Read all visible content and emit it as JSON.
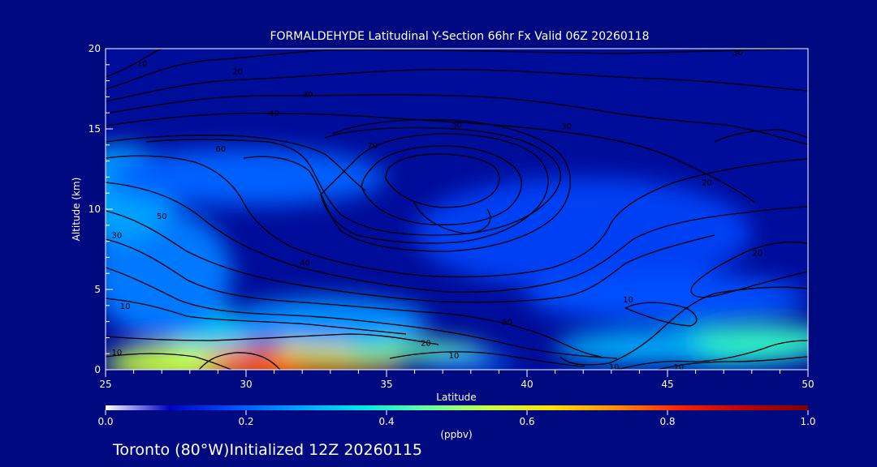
{
  "chart_data": {
    "type": "heatmap",
    "title": "FORMALDEHYDE Latitudinal Y-Section 66hr  Fx Valid 06Z 20260118",
    "xlabel": "Latitude",
    "ylabel": "Altitude (km)",
    "xlim": [
      25,
      50
    ],
    "ylim": [
      0,
      20
    ],
    "x_ticks": [
      "25",
      "30",
      "35",
      "40",
      "45",
      "50"
    ],
    "y_ticks": [
      "0",
      "5",
      "10",
      "15",
      "20"
    ],
    "colorbar": {
      "unit": "(ppbv)",
      "range": [
        0.0,
        1.0
      ],
      "ticks": [
        "0.0",
        "0.2",
        "0.4",
        "0.6",
        "0.8",
        "1.0"
      ],
      "colors": [
        "#ffffff",
        "#0000c8",
        "#0050ff",
        "#00a0ff",
        "#00e6e6",
        "#60ffa0",
        "#c8ff40",
        "#ffe000",
        "#ff8c00",
        "#ff2000",
        "#c00000",
        "#800000"
      ]
    },
    "contour_labels": [
      {
        "text": "10",
        "lat": 26.3,
        "alt": 19.1
      },
      {
        "text": "20",
        "lat": 29.7,
        "alt": 18.6
      },
      {
        "text": "30",
        "lat": 32.2,
        "alt": 17.2
      },
      {
        "text": "40",
        "lat": 31.0,
        "alt": 16.0
      },
      {
        "text": "50",
        "lat": 37.5,
        "alt": 15.3
      },
      {
        "text": "30",
        "lat": 47.5,
        "alt": 19.8
      },
      {
        "text": "30",
        "lat": 41.4,
        "alt": 15.2
      },
      {
        "text": "20",
        "lat": 46.4,
        "alt": 11.7
      },
      {
        "text": "60",
        "lat": 29.1,
        "alt": 13.8
      },
      {
        "text": "70",
        "lat": 34.5,
        "alt": 14.0
      },
      {
        "text": "50",
        "lat": 27.0,
        "alt": 9.6
      },
      {
        "text": "30",
        "lat": 25.4,
        "alt": 8.4
      },
      {
        "text": "40",
        "lat": 32.1,
        "alt": 6.7
      },
      {
        "text": "50",
        "lat": 39.3,
        "alt": 3.0
      },
      {
        "text": "10",
        "lat": 25.7,
        "alt": 4.0
      },
      {
        "text": "10",
        "lat": 43.6,
        "alt": 4.4
      },
      {
        "text": "20",
        "lat": 48.2,
        "alt": 7.3
      },
      {
        "text": "10",
        "lat": 25.4,
        "alt": 1.1
      },
      {
        "text": "20",
        "lat": 36.4,
        "alt": 1.7
      },
      {
        "text": "10",
        "lat": 37.4,
        "alt": 0.9
      },
      {
        "text": "10",
        "lat": 43.1,
        "alt": 0.2
      },
      {
        "text": "10",
        "lat": 45.4,
        "alt": 0.2
      }
    ],
    "heat_blobs": [
      {
        "lat": 28.0,
        "alt": 0.4,
        "rx": 3.0,
        "ry": 1.2,
        "value": 0.5
      },
      {
        "lat": 32.0,
        "alt": 0.3,
        "rx": 3.5,
        "ry": 1.2,
        "value": 0.75
      },
      {
        "lat": 33.5,
        "alt": 0.5,
        "rx": 1.8,
        "ry": 1.0,
        "value": 1.0
      },
      {
        "lat": 33.5,
        "alt": 1.3,
        "rx": 2.5,
        "ry": 0.8,
        "value": 0.55
      },
      {
        "lat": 36.0,
        "alt": 1.2,
        "rx": 2.5,
        "ry": 0.6,
        "value": 0.4
      },
      {
        "lat": 38.0,
        "alt": 0.5,
        "rx": 1.5,
        "ry": 0.5,
        "value": 0.15
      },
      {
        "lat": 29.0,
        "alt": 2.5,
        "rx": 2.0,
        "ry": 1.2,
        "value": 0.25
      },
      {
        "lat": 33.0,
        "alt": 3.0,
        "rx": 3.5,
        "ry": 1.5,
        "value": 0.18
      },
      {
        "lat": 27.0,
        "alt": 6.0,
        "rx": 2.5,
        "ry": 4.0,
        "value": 0.15
      },
      {
        "lat": 25.5,
        "alt": 11.0,
        "rx": 2.0,
        "ry": 3.0,
        "value": 0.2
      },
      {
        "lat": 30.0,
        "alt": 12.0,
        "rx": 5.0,
        "ry": 1.8,
        "value": 0.12
      },
      {
        "lat": 42.0,
        "alt": 8.5,
        "rx": 6.0,
        "ry": 3.5,
        "value": 0.08
      },
      {
        "lat": 47.0,
        "alt": 1.5,
        "rx": 3.5,
        "ry": 1.2,
        "value": 0.3
      },
      {
        "lat": 44.0,
        "alt": 1.4,
        "rx": 3.0,
        "ry": 1.0,
        "value": 0.22
      },
      {
        "lat": 48.5,
        "alt": 1.8,
        "rx": 2.5,
        "ry": 1.0,
        "value": 0.35
      },
      {
        "lat": 45.0,
        "alt": 4.5,
        "rx": 5.0,
        "ry": 1.5,
        "value": 0.1
      }
    ]
  },
  "footer": {
    "location": "Toronto (80°W)Initialized 12Z 20260115"
  }
}
